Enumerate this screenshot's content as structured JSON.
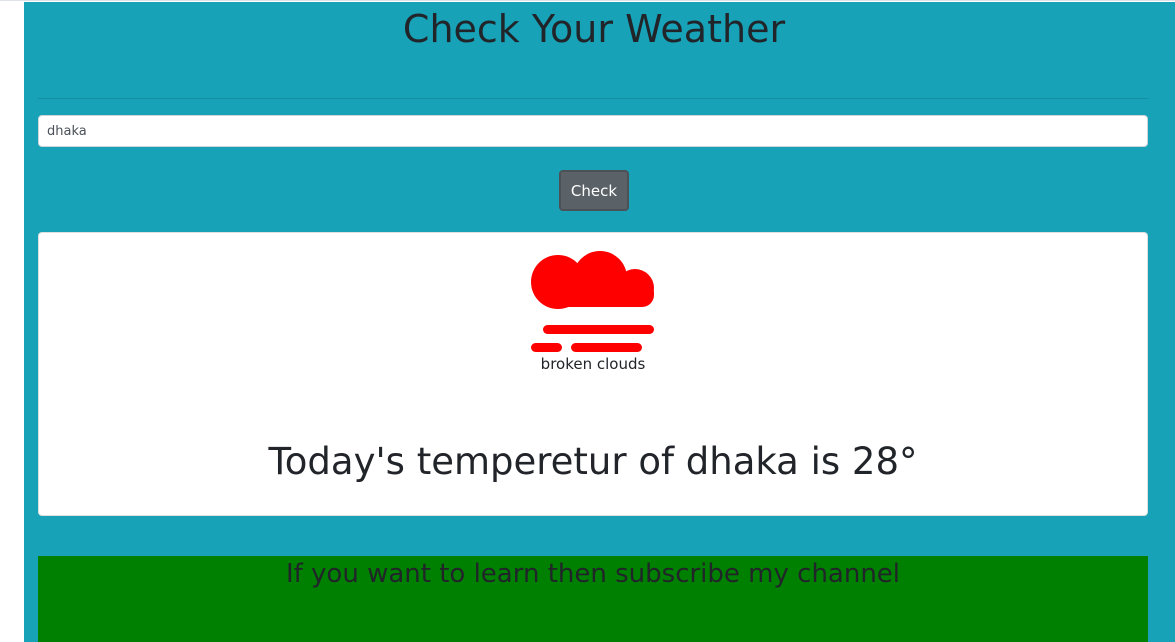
{
  "header": {
    "title": "Check Your Weather"
  },
  "search": {
    "value": "dhaka"
  },
  "check_button": {
    "label": "Check"
  },
  "weather": {
    "icon": "mist-cloud-icon",
    "icon_color": "#ff0000",
    "description": "broken clouds",
    "temperature_text": "Today's temperetur of dhaka is 28°"
  },
  "promo": {
    "text": "If you want to learn then subscribe my channel",
    "background": "#008000"
  },
  "colors": {
    "panel_background": "#17a2b8",
    "button_background": "#5a6268"
  }
}
